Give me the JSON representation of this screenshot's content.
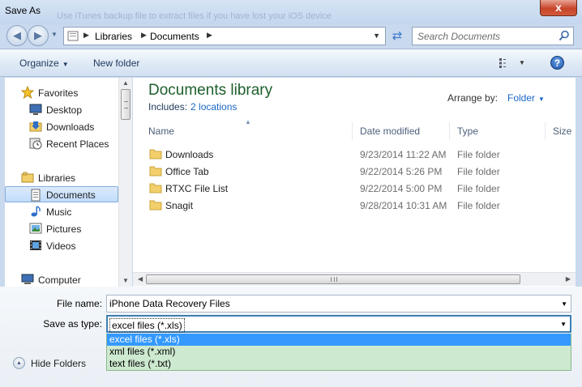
{
  "window": {
    "title": "Save As",
    "background_text": "Use iTunes backup file to extract files if you have lost your iOS device",
    "close_glyph": "x"
  },
  "address": {
    "crumbs": [
      "Libraries",
      "Documents"
    ],
    "search_placeholder": "Search Documents"
  },
  "toolbar": {
    "organize": "Organize",
    "new_folder": "New folder",
    "help": "?"
  },
  "nav": {
    "items": [
      {
        "label": "Favorites",
        "icon": "star-icon"
      },
      {
        "label": "Desktop",
        "icon": "desktop-icon"
      },
      {
        "label": "Downloads",
        "icon": "downloads-icon"
      },
      {
        "label": "Recent Places",
        "icon": "recent-places-icon"
      },
      {
        "label": "Libraries",
        "icon": "libraries-icon"
      },
      {
        "label": "Documents",
        "icon": "documents-icon",
        "selected": true
      },
      {
        "label": "Music",
        "icon": "music-icon"
      },
      {
        "label": "Pictures",
        "icon": "pictures-icon"
      },
      {
        "label": "Videos",
        "icon": "videos-icon"
      },
      {
        "label": "Computer",
        "icon": "computer-icon"
      }
    ]
  },
  "library": {
    "title": "Documents library",
    "includes_label": "Includes:",
    "includes_link": "2 locations",
    "arrange_label": "Arrange by:",
    "arrange_value": "Folder"
  },
  "columns": [
    "Name",
    "Date modified",
    "Type",
    "Size"
  ],
  "files": [
    {
      "name": "Downloads",
      "date": "9/23/2014 11:22 AM",
      "type": "File folder"
    },
    {
      "name": "Office Tab",
      "date": "9/22/2014 5:26 PM",
      "type": "File folder"
    },
    {
      "name": "RTXC File List",
      "date": "9/22/2014 5:00 PM",
      "type": "File folder"
    },
    {
      "name": "Snagit",
      "date": "9/28/2014 10:31 AM",
      "type": "File folder"
    }
  ],
  "bottom": {
    "file_name_label": "File name:",
    "file_name_value": "iPhone Data Recovery Files",
    "save_type_label": "Save as type:",
    "save_type_value": "excel files (*.xls)",
    "type_options": [
      "excel files (*.xls)",
      "xml files (*.xml)",
      "text files (*.txt)"
    ],
    "hide_folders": "Hide Folders"
  },
  "colors": {
    "accent": "#1a67c5",
    "library_title": "#1d5f2b",
    "selection": "#3399ff",
    "dropdown_bg": "#cde9cf"
  }
}
